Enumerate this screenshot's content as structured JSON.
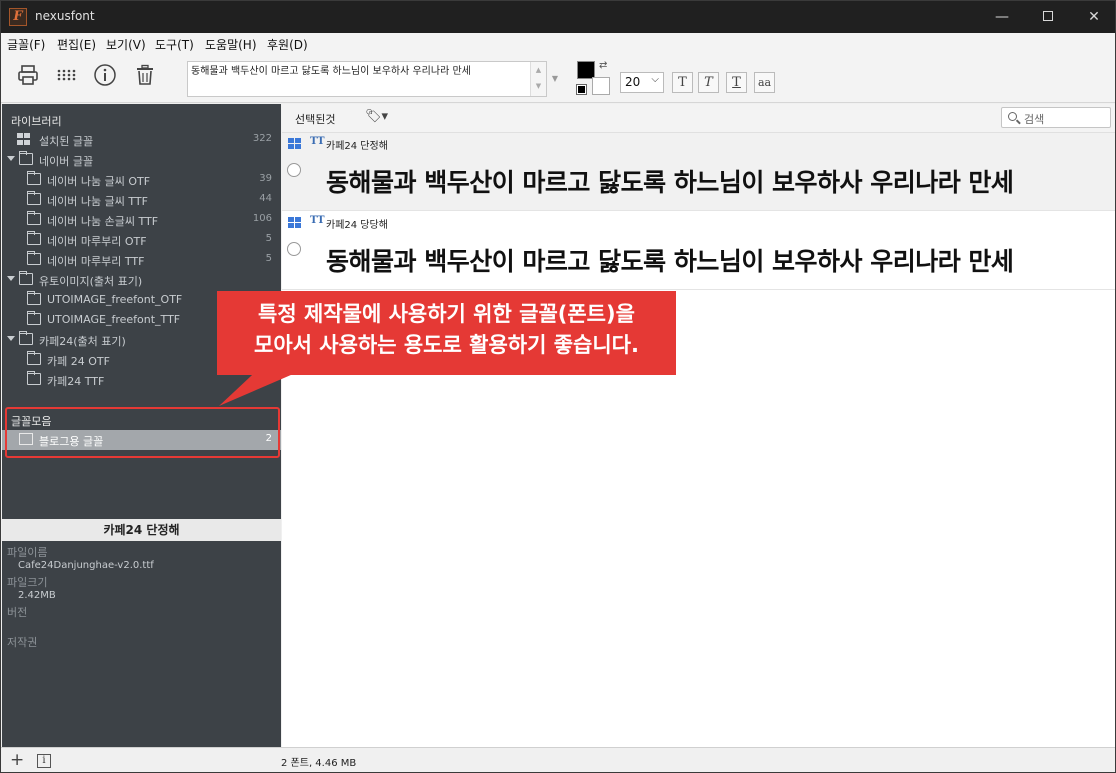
{
  "window": {
    "title": "nexusfont",
    "logo_letter": "F",
    "minimize": "—",
    "close": "✕"
  },
  "menu": [
    "글꼴(F)",
    "편집(E)",
    "보기(V)",
    "도구(T)",
    "도움말(H)",
    "후원(D)"
  ],
  "toolbar": {
    "icons": [
      "printer-icon",
      "grid-icon",
      "info-icon",
      "trash-icon"
    ],
    "sample_text": "동해물과 백두산이 마르고 닳도록 하느님이 보우하사 우리나라 만세",
    "font_size": "20",
    "format_buttons": [
      "T",
      "T",
      "T",
      "aa"
    ],
    "fg_color": "#000000",
    "bg_color": "#ffffff"
  },
  "sidebar": {
    "library_header": "라이브러리",
    "installed": {
      "label": "설치된 글꼴",
      "count": "322"
    },
    "groups": [
      {
        "label": "네이버 글꼴",
        "children": [
          {
            "label": "네이버 나눔 글씨 OTF",
            "count": "39"
          },
          {
            "label": "네이버 나눔 글씨 TTF",
            "count": "44"
          },
          {
            "label": "네이버 나눔 손글씨 TTF",
            "count": "106"
          },
          {
            "label": "네이버 마루부리 OTF",
            "count": "5"
          },
          {
            "label": "네이버 마루부리 TTF",
            "count": "5"
          }
        ]
      },
      {
        "label": "유토이미지(출처 표기)",
        "children": [
          {
            "label": "UTOIMAGE_freefont_OTF",
            "count": ""
          },
          {
            "label": "UTOIMAGE_freefont_TTF",
            "count": ""
          }
        ]
      },
      {
        "label": "카페24(출처 표기)",
        "children": [
          {
            "label": "카페 24 OTF",
            "count": ""
          },
          {
            "label": "카페24 TTF",
            "count": "2"
          }
        ]
      }
    ],
    "collection_header": "글꼴모음",
    "collection_item": {
      "label": "블로그용 글꼴",
      "count": "2"
    }
  },
  "info": {
    "title": "카페24 단정해",
    "file_name_label": "파일이름",
    "file_name": "Cafe24Danjunghae-v2.0.ttf",
    "file_size_label": "파일크기",
    "file_size": "2.42MB",
    "version_label": "버전",
    "copyright_label": "저작권"
  },
  "main": {
    "selected_label": "선택된것",
    "tag_icon": "tag-icon",
    "search_placeholder": "검색",
    "fonts": [
      {
        "name": "카페24 단정해",
        "sample": "동해물과 백두산이 마르고 닳도록 하느님이 보우하사 우리나라 만세"
      },
      {
        "name": "카페24 당당해",
        "sample": "동해물과 백두산이 마르고 닳도록 하느님이 보우하사 우리나라 만세"
      }
    ]
  },
  "callout": {
    "line1": "특정 제작물에 사용하기 위한 글꼴(폰트)을",
    "line2": "모아서 사용하는 용도로 활용하기 좋습니다.",
    "color": "#e53935"
  },
  "statusbar": {
    "add": "+",
    "info": "i",
    "status": "2 폰트, 4.46 MB"
  }
}
